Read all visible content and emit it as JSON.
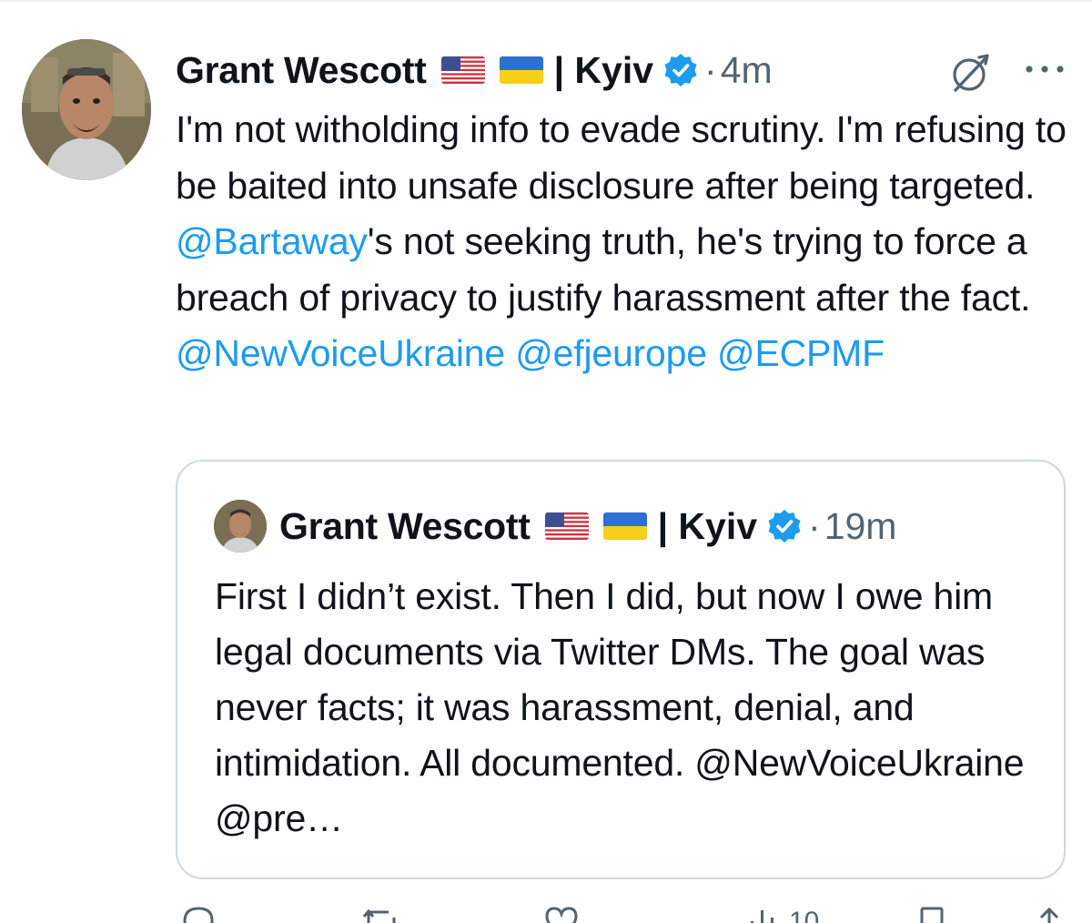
{
  "tweet": {
    "author_name": "Grant Wescott",
    "location": "| Kyiv",
    "separator": "·",
    "timestamp": "4m",
    "text_parts": [
      "I'm not witholding info to evade scrutiny. I'm refusing to be baited into unsafe disclosure after being targeted. ",
      "@Bartaway",
      "'s not seeking truth, he's trying to force a breach of privacy to justify harassment after the fact.",
      "@NewVoiceUkraine",
      "@efjeurope",
      "@ECPMF"
    ]
  },
  "quoted_tweet": {
    "author_name": "Grant Wescott",
    "location": "| Kyiv",
    "separator": "·",
    "timestamp": "19m",
    "text": "First I didn’t exist. Then I did, but now I owe him legal documents via Twitter DMs. The goal was never facts; it was harassment, denial, and intimidation. All documented. @NewVoiceUkraine @pre…"
  },
  "actions": {
    "views_count": "10"
  },
  "icons": {
    "verified": "verified-badge-icon",
    "grok": "grok-icon",
    "more": "more-options-icon",
    "flag_us": "us-flag-icon",
    "flag_ua": "ukraine-flag-icon"
  },
  "colors": {
    "link": "#1d9bf0",
    "text": "#0f1419",
    "secondary": "#536471",
    "border": "#cfd9de"
  }
}
